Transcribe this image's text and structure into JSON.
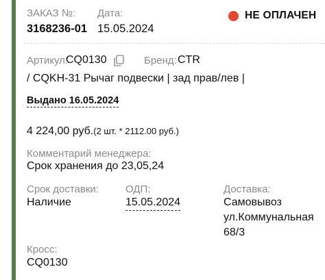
{
  "order": {
    "number_label": "ЗАКАЗ №:",
    "number": "3168236-01",
    "date_label": "Дата:",
    "date": "15.05.2024",
    "status_text": "НЕ ОПЛАЧЕН",
    "status_color": "#e5462e",
    "accent_color": "#55804b"
  },
  "item": {
    "article_label": "Артикул:",
    "article": "CQ0130",
    "copy_icon": "copy-icon",
    "brand_label": "Бренд:",
    "brand": "CTR",
    "description": "/ CQKH-31 Рычаг подвески | зад прав/лев |",
    "issued": "Выдано 16.05.2024",
    "price": "4 224,00 руб.",
    "price_detail": "(2 шт. * 2112.00 руб.)",
    "manager_comment_label": "Комментарий менеджера:",
    "manager_comment": "Срок хранения до 23,05,24",
    "delivery_term_label": "Срок доставки:",
    "delivery_term": "Наличие",
    "odp_label": "ОДП:",
    "odp": "15.05.2024",
    "delivery_label": "Доставка:",
    "delivery_line1": "Самовывоз",
    "delivery_line2": "ул.Коммунальная",
    "delivery_line3": "68/3",
    "cross_label": "Кросс:",
    "cross": "CQ0130"
  }
}
